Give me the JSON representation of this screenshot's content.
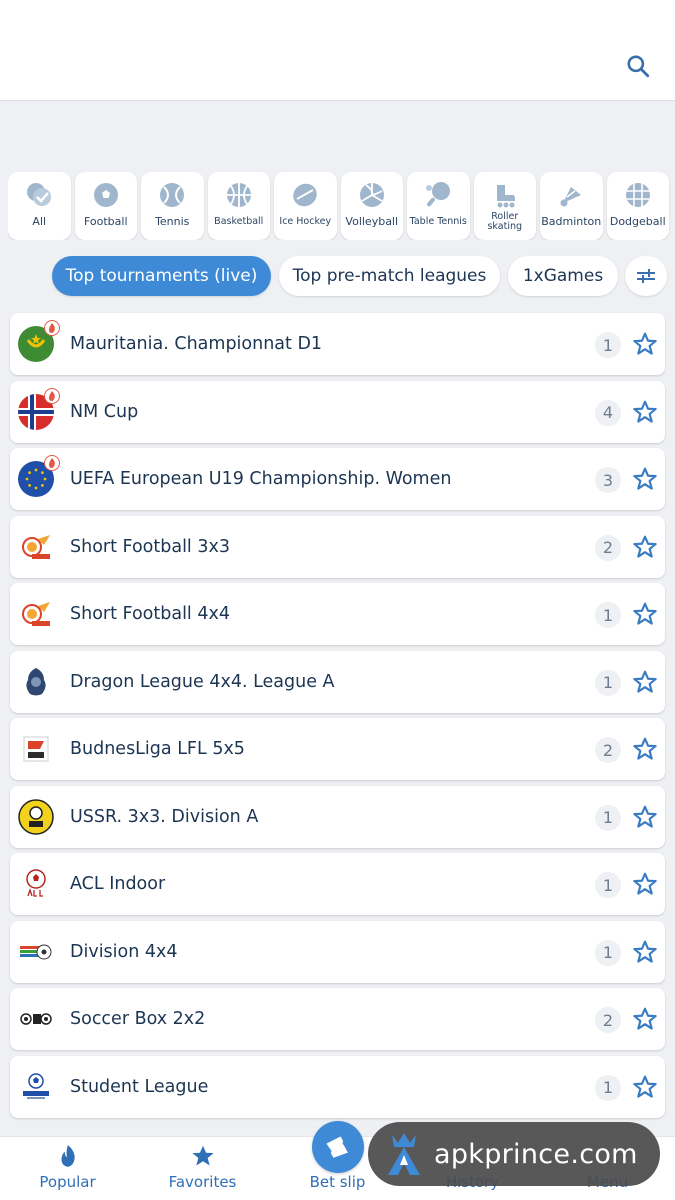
{
  "header": {
    "search_icon": "search-icon"
  },
  "sports": [
    {
      "label": "All",
      "icon": "all-sports-icon"
    },
    {
      "label": "Football",
      "icon": "football-icon"
    },
    {
      "label": "Tennis",
      "icon": "tennis-icon"
    },
    {
      "label": "Basketball",
      "icon": "basketball-icon"
    },
    {
      "label": "Ice Hockey",
      "icon": "ice-hockey-icon"
    },
    {
      "label": "Volleyball",
      "icon": "volleyball-icon"
    },
    {
      "label": "Table Tennis",
      "icon": "table-tennis-icon"
    },
    {
      "label": "Roller skating",
      "icon": "roller-skating-icon"
    },
    {
      "label": "Badminton",
      "icon": "badminton-icon"
    },
    {
      "label": "Dodgeball",
      "icon": "dodgeball-icon"
    }
  ],
  "filters": {
    "tabs": [
      "Top tournaments (live)",
      "Top pre-match leagues",
      "1xGames"
    ],
    "active": "Top tournaments (live)"
  },
  "tournaments": [
    {
      "name": "Mauritania. Championnat D1",
      "count": "1",
      "live": true
    },
    {
      "name": "NM Cup",
      "count": "4",
      "live": true
    },
    {
      "name": "UEFA European U19 Championship. Women",
      "count": "3",
      "live": true
    },
    {
      "name": "Short Football 3x3",
      "count": "2",
      "live": false
    },
    {
      "name": "Short Football 4x4",
      "count": "1",
      "live": false
    },
    {
      "name": "Dragon League 4x4. League A",
      "count": "1",
      "live": false
    },
    {
      "name": "BudnesLiga LFL 5x5",
      "count": "2",
      "live": false
    },
    {
      "name": "USSR. 3x3. Division A",
      "count": "1",
      "live": false
    },
    {
      "name": "ACL Indoor",
      "count": "1",
      "live": false
    },
    {
      "name": "Division 4x4",
      "count": "1",
      "live": false
    },
    {
      "name": "Soccer Box 2x2",
      "count": "2",
      "live": false
    },
    {
      "name": "Student League",
      "count": "1",
      "live": false
    }
  ],
  "bottom_nav": {
    "popular": "Popular",
    "favorites": "Favorites",
    "bet_slip": "Bet slip",
    "history": "History",
    "menu": "Menu"
  },
  "watermark": {
    "text": "apkprince.com"
  },
  "colors": {
    "accent": "#3f8ad6",
    "text": "#1c3553",
    "live": "#e05a47"
  }
}
